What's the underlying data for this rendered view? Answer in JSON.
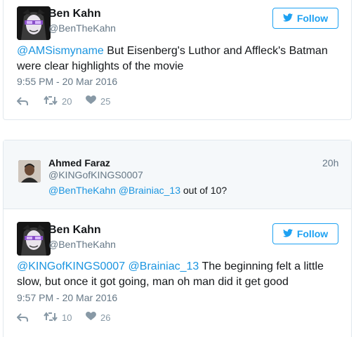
{
  "tweet1": {
    "name": "Ben Kahn",
    "handle": "@BenTheKahn",
    "follow_label": "Follow",
    "mention": "@AMSismyname",
    "text_line1": " But Eisenberg's Luthor and Affleck's Batman",
    "text_line2": "were clear highlights of the movie",
    "timestamp": "9:55 PM - 20 Mar 2016",
    "retweets": "20",
    "likes": "25"
  },
  "reply": {
    "name": "Ahmed Faraz",
    "handle": "@KINGofKINGS0007",
    "time_ago": "20h",
    "mention1": "@BenTheKahn",
    "mention2": "@Brainiac_13",
    "text": " out of 10?"
  },
  "tweet2": {
    "name": "Ben Kahn",
    "handle": "@BenTheKahn",
    "follow_label": "Follow",
    "mention1": "@KINGofKINGS0007",
    "mention2": "@Brainiac_13",
    "text_line1": " The beginning felt a little",
    "text_line2": "slow, but once it got going, man oh man did it get good",
    "timestamp": "9:57 PM - 20 Mar 2016",
    "retweets": "10",
    "likes": "26"
  },
  "colors": {
    "accent": "#1da1f2",
    "link": "#1b95e0",
    "muted": "#657786",
    "border": "#e1e8ed",
    "reply_bg": "#f5f8fa"
  },
  "icons": [
    "bird-icon",
    "reply-icon",
    "retweet-icon",
    "heart-icon"
  ]
}
